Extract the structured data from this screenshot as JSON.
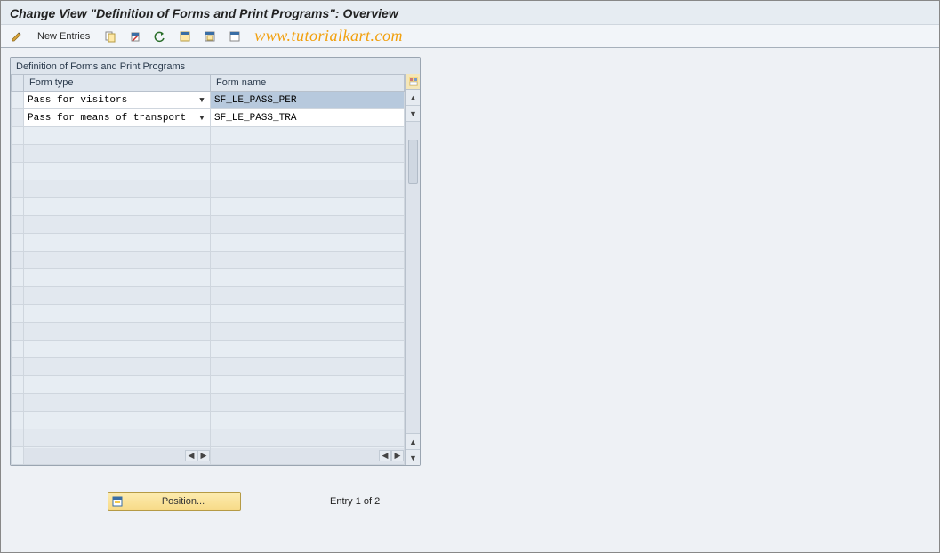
{
  "header": {
    "title": "Change View \"Definition of Forms and Print Programs\": Overview"
  },
  "toolbar": {
    "new_entries_label": "New Entries",
    "watermark": "www.tutorialkart.com"
  },
  "panel": {
    "title": "Definition of Forms and Print Programs",
    "columns": {
      "form_type": "Form type",
      "form_name": "Form name"
    },
    "rows": [
      {
        "form_type": "Pass for visitors",
        "form_name": "SF_LE_PASS_PER",
        "selected": true
      },
      {
        "form_type": "Pass for means of transport",
        "form_name": "SF_LE_PASS_TRA",
        "selected": false
      }
    ],
    "empty_row_count": 18
  },
  "footer": {
    "position_label": "Position...",
    "entry_status": "Entry 1 of 2"
  }
}
